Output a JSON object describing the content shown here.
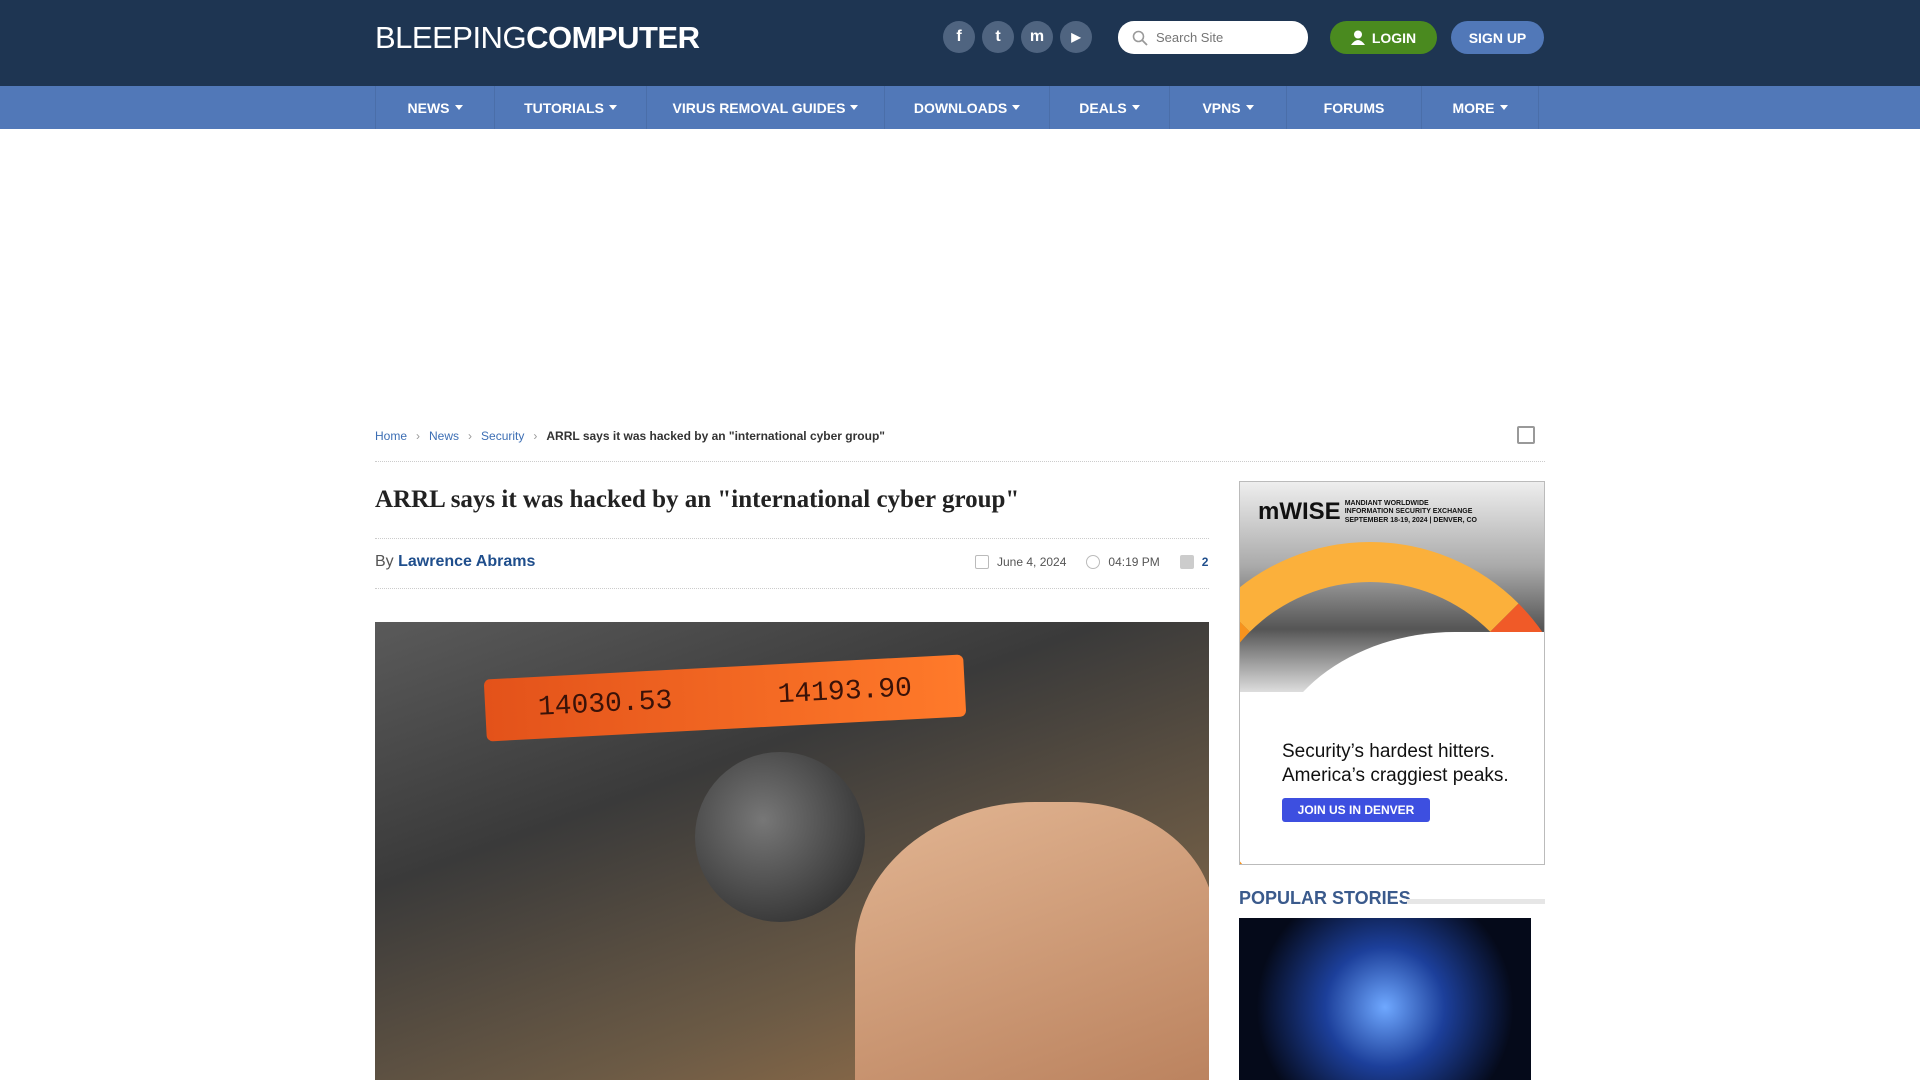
{
  "header": {
    "logo_light": "BLEEPING",
    "logo_bold": "COMPUTER",
    "social": [
      {
        "icon": "facebook-icon",
        "glyph": "f"
      },
      {
        "icon": "twitter-icon",
        "glyph": "t"
      },
      {
        "icon": "mastodon-icon",
        "glyph": "m"
      },
      {
        "icon": "youtube-icon",
        "glyph": "▶"
      }
    ],
    "search_placeholder": "Search Site",
    "login": "LOGIN",
    "signup": "SIGN UP"
  },
  "nav": [
    {
      "label": "NEWS",
      "caret": true
    },
    {
      "label": "TUTORIALS",
      "caret": true
    },
    {
      "label": "VIRUS REMOVAL GUIDES",
      "caret": true
    },
    {
      "label": "DOWNLOADS",
      "caret": true
    },
    {
      "label": "DEALS",
      "caret": true
    },
    {
      "label": "VPNS",
      "caret": true
    },
    {
      "label": "FORUMS",
      "caret": false
    },
    {
      "label": "MORE",
      "caret": true
    }
  ],
  "breadcrumb": {
    "home": "Home",
    "news": "News",
    "security": "Security",
    "current": "ARRL says it was hacked by an \"international cyber group\""
  },
  "article": {
    "title": "ARRL says it was hacked by an \"international cyber group\"",
    "by": "By",
    "author": "Lawrence Abrams",
    "date": "June 4, 2024",
    "time": "04:19 PM",
    "comments": "2",
    "display_a": "14030.53",
    "display_b": "14193.90"
  },
  "ad": {
    "brand": "mWISE",
    "brand_sub1": "MANDIANT WORLDWIDE",
    "brand_sub2": "INFORMATION SECURITY EXCHANGE",
    "brand_sub3": "SEPTEMBER 18-19, 2024 | DENVER, CO",
    "line1": "Security’s hardest hitters.",
    "line2": "America’s craggiest peaks.",
    "cta": "JOIN US IN DENVER"
  },
  "sidebar": {
    "popular_title": "POPULAR STORIES"
  },
  "colors": {
    "header": "#1e3552",
    "nav": "#5178b8",
    "login": "#4a8a1f",
    "link": "#3c6eb4"
  }
}
